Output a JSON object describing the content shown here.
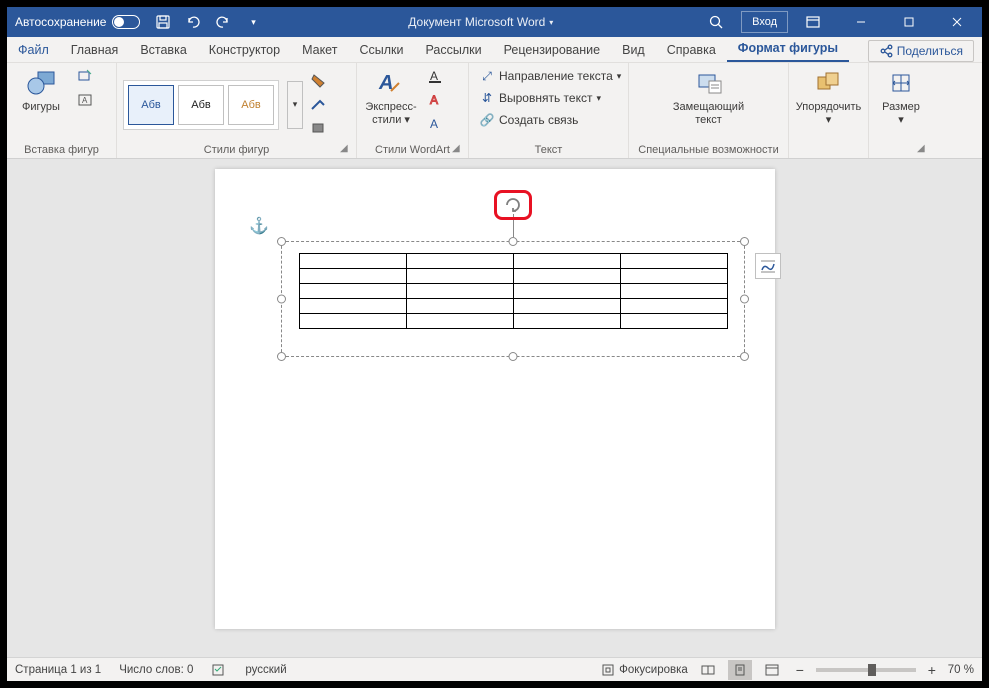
{
  "titlebar": {
    "autosave": "Автосохранение",
    "title": "Документ Microsoft Word",
    "login": "Вход"
  },
  "tabs": {
    "file": "Файл",
    "home": "Главная",
    "insert": "Вставка",
    "design": "Конструктор",
    "layout": "Макет",
    "references": "Ссылки",
    "mailings": "Рассылки",
    "review": "Рецензирование",
    "view": "Вид",
    "help": "Справка",
    "shape_format": "Формат фигуры",
    "share": "Поделиться"
  },
  "ribbon": {
    "insert_shapes": {
      "shapes": "Фигуры",
      "label": "Вставка фигур"
    },
    "shape_styles": {
      "sample": "Абв",
      "label": "Стили фигур"
    },
    "wordart": {
      "express": "Экспресс-стили",
      "label": "Стили WordArt"
    },
    "text": {
      "direction": "Направление текста",
      "align": "Выровнять текст",
      "link": "Создать связь",
      "label": "Текст"
    },
    "accessibility": {
      "alt": "Замещающий текст",
      "label": "Специальные возможности"
    },
    "arrange": {
      "arrange": "Упорядочить"
    },
    "size": {
      "size": "Размер"
    }
  },
  "status": {
    "page": "Страница 1 из 1",
    "words": "Число слов: 0",
    "lang": "русский",
    "focus": "Фокусировка",
    "zoom": "70 %"
  }
}
